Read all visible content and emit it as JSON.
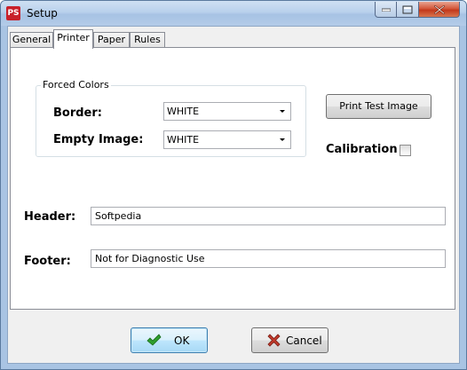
{
  "window": {
    "title": "Setup",
    "app_icon_text": "PS"
  },
  "tabs": [
    {
      "label": "General",
      "active": false
    },
    {
      "label": "Printer",
      "active": true
    },
    {
      "label": "Paper",
      "active": false
    },
    {
      "label": "Rules",
      "active": false
    }
  ],
  "forced_colors": {
    "group_label": "Forced Colors",
    "border_label": "Border:",
    "border_value": "WHITE",
    "empty_image_label": "Empty Image:",
    "empty_image_value": "WHITE"
  },
  "print_test_button": "Print Test Image",
  "calibration": {
    "label": "Calibration",
    "checked": false
  },
  "header": {
    "label": "Header:",
    "value": "Softpedia"
  },
  "footer": {
    "label": "Footer:",
    "value": "Not for Diagnostic Use"
  },
  "buttons": {
    "ok": "OK",
    "cancel": "Cancel"
  },
  "colors": {
    "ok_check": "#2e9e2e",
    "cancel_x": "#c0392b",
    "close_button": "#c2381b"
  }
}
